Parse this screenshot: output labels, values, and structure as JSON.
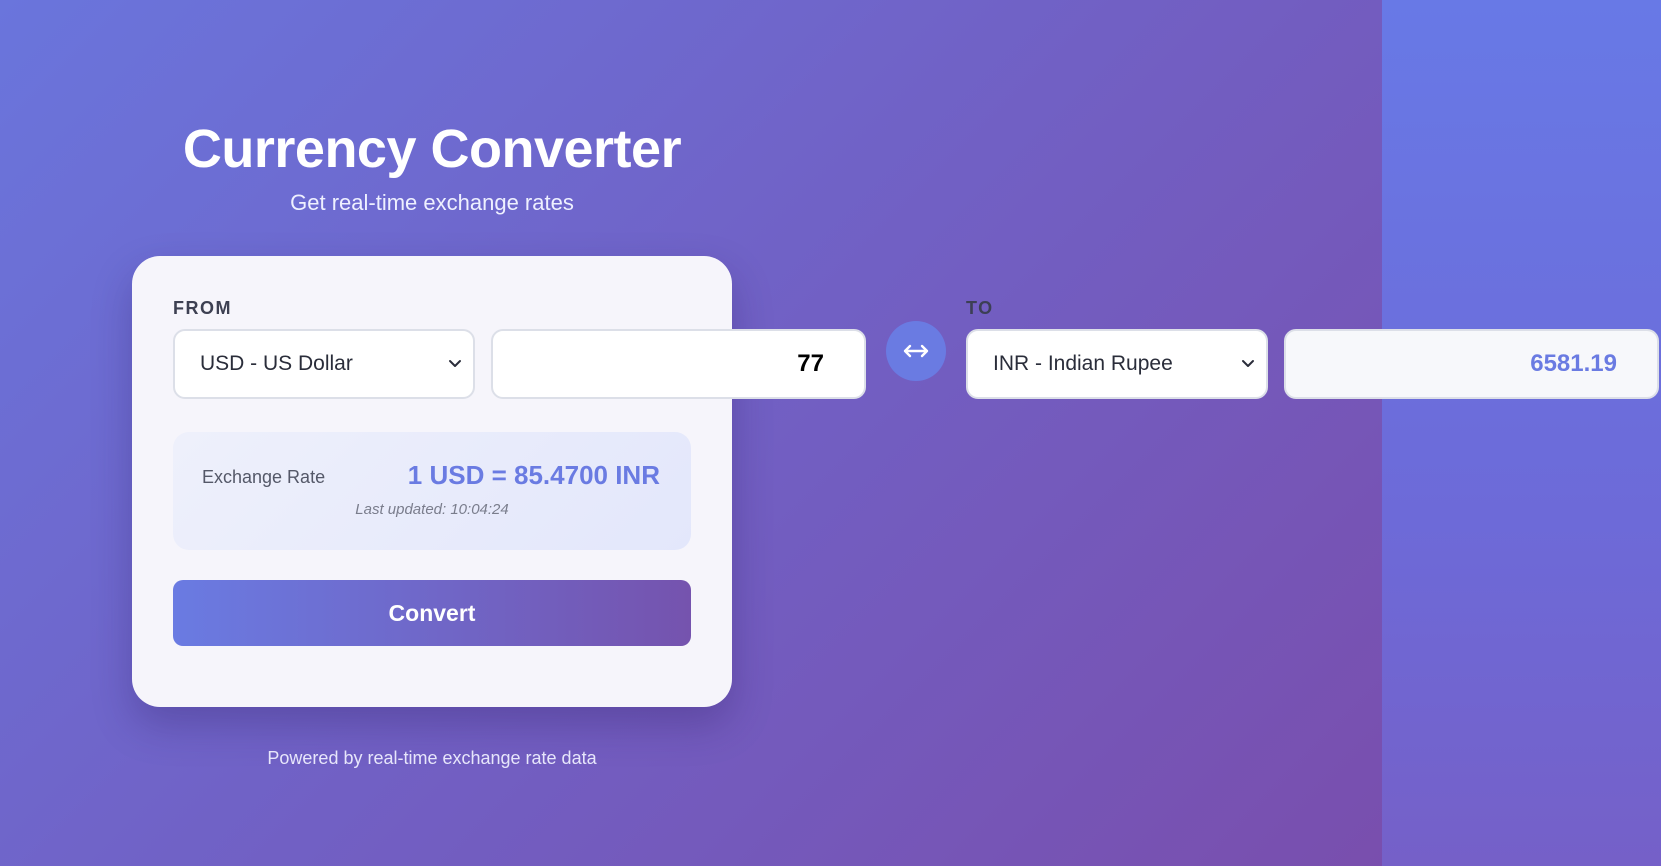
{
  "header": {
    "title": "Currency Converter",
    "subtitle": "Get real-time exchange rates"
  },
  "from": {
    "label": "FROM",
    "currency": "USD - US Dollar",
    "amount": "77"
  },
  "to": {
    "label": "TO",
    "currency": "INR - Indian Rupee",
    "amount": "6581.19"
  },
  "rate": {
    "label": "Exchange Rate",
    "value": "1 USD = 85.4700 INR",
    "last_updated": "Last updated: 10:04:24"
  },
  "actions": {
    "convert_label": "Convert",
    "swap_icon": "swap-arrows-icon"
  },
  "footer": {
    "text": "Powered by real-time exchange rate data"
  },
  "colors": {
    "accent": "#6a7be2",
    "background_start": "#6a75dc",
    "background_end": "#7b4aa8",
    "card": "#f6f5fb"
  }
}
